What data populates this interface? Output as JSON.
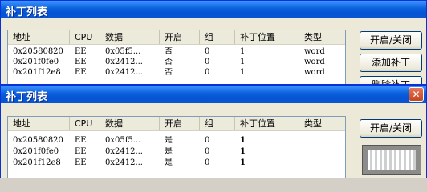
{
  "windows": [
    {
      "title": "补丁列表",
      "columns": [
        "地址",
        "CPU",
        "数据",
        "开启",
        "组",
        "补丁位置",
        "类型"
      ],
      "rows": [
        [
          "0x20580820",
          "EE",
          "0x05f5...",
          "否",
          "0",
          "1",
          "word"
        ],
        [
          "0x201f0fe0",
          "EE",
          "0x2412...",
          "否",
          "0",
          "1",
          "word"
        ],
        [
          "0x201f12e8",
          "EE",
          "0x2412...",
          "否",
          "0",
          "1",
          "word"
        ]
      ],
      "buttons": {
        "toggle": "开启/关闭",
        "add": "添加补丁",
        "cut": "删除补丁"
      }
    },
    {
      "title": "补丁列表",
      "columns": [
        "地址",
        "CPU",
        "数据",
        "开启",
        "组",
        "补丁位置",
        "类型"
      ],
      "rows": [
        [
          "0x20580820",
          "EE",
          "0x05f5...",
          "是",
          "0",
          "1",
          ""
        ],
        [
          "0x201f0fe0",
          "EE",
          "0x2412...",
          "是",
          "0",
          "1",
          ""
        ],
        [
          "0x201f12e8",
          "EE",
          "0x2412...",
          "是",
          "0",
          "1",
          ""
        ]
      ],
      "buttons": {
        "toggle": "开启/关闭"
      }
    }
  ],
  "icons": {
    "close": "close-icon"
  },
  "colors": {
    "titlebar": "#0a5fdc",
    "window_bg": "#ece9d8",
    "list_border": "#7f9db9"
  }
}
